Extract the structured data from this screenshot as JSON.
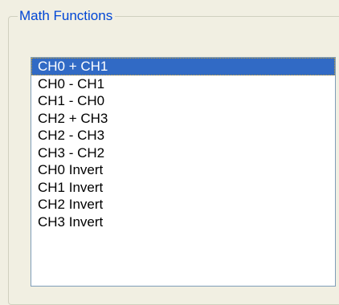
{
  "group": {
    "title": "Math Functions"
  },
  "list": {
    "selected_index": 0,
    "items": [
      {
        "label": "CH0 + CH1"
      },
      {
        "label": "CH0 - CH1"
      },
      {
        "label": "CH1 - CH0"
      },
      {
        "label": "CH2 + CH3"
      },
      {
        "label": "CH2 - CH3"
      },
      {
        "label": "CH3 - CH2"
      },
      {
        "label": "CH0 Invert"
      },
      {
        "label": "CH1 Invert"
      },
      {
        "label": "CH2 Invert"
      },
      {
        "label": "CH3 Invert"
      }
    ]
  },
  "colors": {
    "selection": "#316ac5",
    "title_text": "#0046d5",
    "background": "#f1efe2"
  }
}
